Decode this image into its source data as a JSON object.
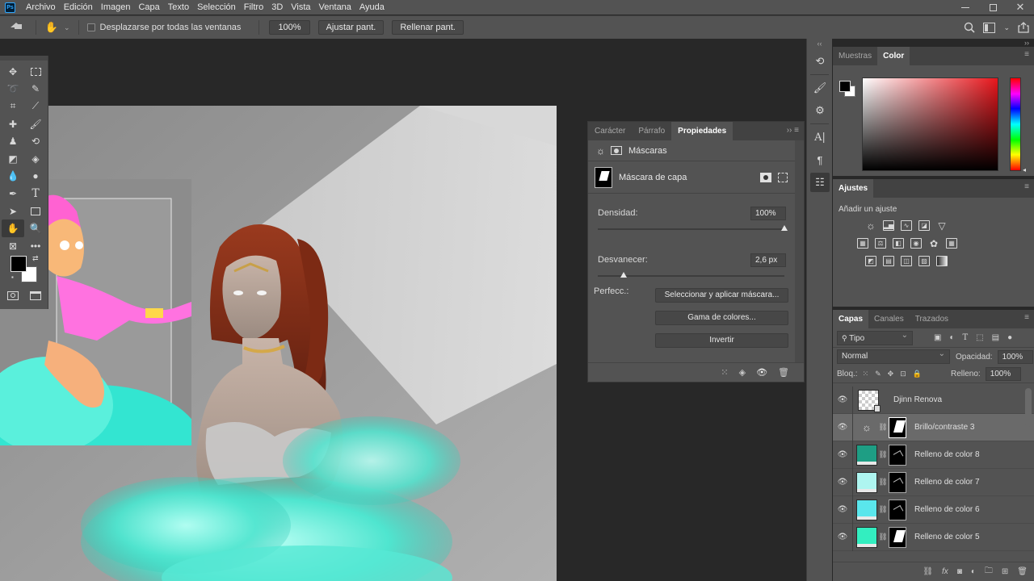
{
  "menu": {
    "app_logo": "Ps",
    "items": [
      "Archivo",
      "Edición",
      "Imagen",
      "Capa",
      "Texto",
      "Selección",
      "Filtro",
      "3D",
      "Vista",
      "Ventana",
      "Ayuda"
    ]
  },
  "options": {
    "scroll_all_label": "Desplazarse por todas las ventanas",
    "zoom_value": "100%",
    "fit_label": "Ajustar pant.",
    "fill_label": "Rellenar pant."
  },
  "properties": {
    "tabs": [
      "Carácter",
      "Párrafo",
      "Propiedades"
    ],
    "active_tab": "Propiedades",
    "section": "Máscaras",
    "mask_label": "Máscara de capa",
    "density_label": "Densidad:",
    "density_value": "100%",
    "density_level": 1.0,
    "feather_label": "Desvanecer:",
    "feather_value": "2,6 px",
    "feather_level": 0.14,
    "refine_label": "Perfecc.:",
    "btn_select_mask": "Seleccionar y aplicar máscara...",
    "btn_color_range": "Gama de colores...",
    "btn_invert": "Invertir"
  },
  "color_panel": {
    "tabs": [
      "Muestras",
      "Color"
    ],
    "active_tab": "Color",
    "foreground": "#000000",
    "background": "#ffffff"
  },
  "adjustments": {
    "title": "Ajustes",
    "add_label": "Añadir un ajuste"
  },
  "layers_panel": {
    "tabs": [
      "Capas",
      "Canales",
      "Trazados"
    ],
    "active_tab": "Capas",
    "kind_filter": "Tipo",
    "blend_mode": "Normal",
    "opacity_label": "Opacidad:",
    "opacity_value": "100%",
    "lock_label": "Bloq.:",
    "fill_label": "Relleno:",
    "fill_value": "100%",
    "layers": [
      {
        "name": "Djinn Renova",
        "kind": "smart"
      },
      {
        "name": "Brillo/contraste 3",
        "kind": "adjustment",
        "selected": true
      },
      {
        "name": "Relleno de color 8",
        "kind": "fill",
        "color": "#1e9e84"
      },
      {
        "name": "Relleno de color 7",
        "kind": "fill",
        "color": "#aef5f0"
      },
      {
        "name": "Relleno de color 6",
        "kind": "fill",
        "color": "#5ae6ec"
      },
      {
        "name": "Relleno de color 5",
        "kind": "fill",
        "color": "#33eec0"
      }
    ]
  }
}
